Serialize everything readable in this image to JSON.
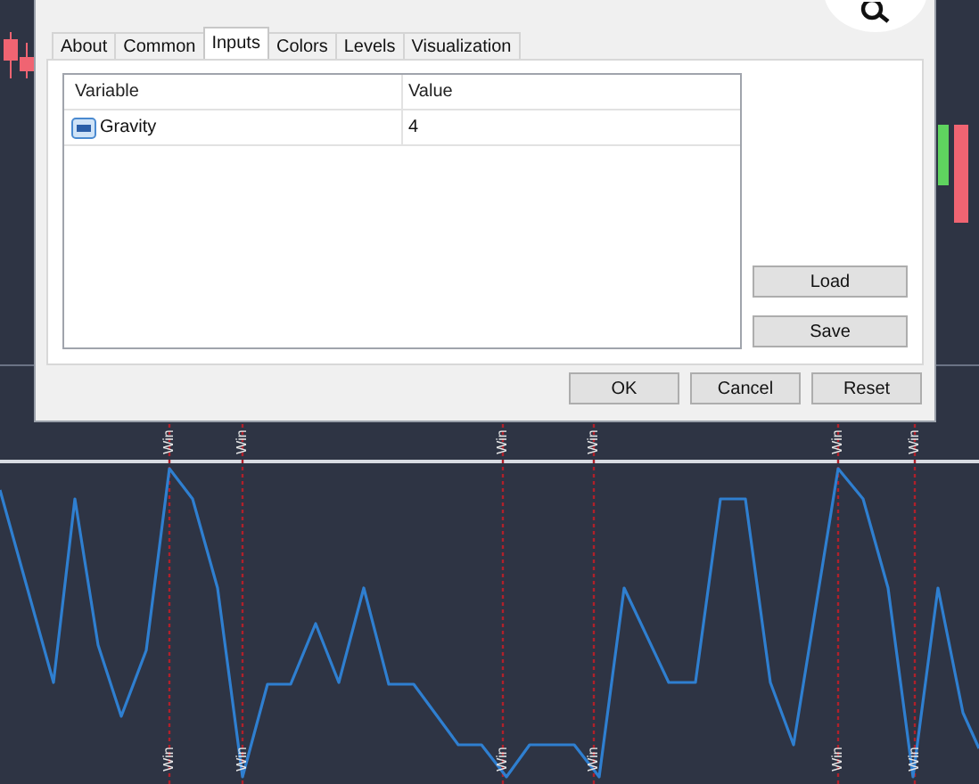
{
  "dialog": {
    "tabs": [
      {
        "label": "About",
        "selected": false
      },
      {
        "label": "Common",
        "selected": false
      },
      {
        "label": "Inputs",
        "selected": true
      },
      {
        "label": "Colors",
        "selected": false
      },
      {
        "label": "Levels",
        "selected": false
      },
      {
        "label": "Visualization",
        "selected": false
      }
    ],
    "table": {
      "columns": [
        "Variable",
        "Value"
      ],
      "rows": [
        {
          "variable": "Gravity",
          "value": "4"
        }
      ]
    },
    "side_buttons": [
      "Load",
      "Save"
    ],
    "buttons": [
      "OK",
      "Cancel",
      "Reset"
    ]
  },
  "chart": {
    "signals": [
      {
        "top_label": "Win",
        "bottom_label": "Win"
      },
      {
        "top_label": "Win",
        "bottom_label": "Win"
      },
      {
        "top_label": "Win",
        "bottom_label": "Win"
      },
      {
        "top_label": "Win",
        "bottom_label": "Win"
      },
      {
        "top_label": "Win",
        "bottom_label": "Win"
      },
      {
        "top_label": "Win",
        "bottom_label": "Win"
      }
    ]
  }
}
